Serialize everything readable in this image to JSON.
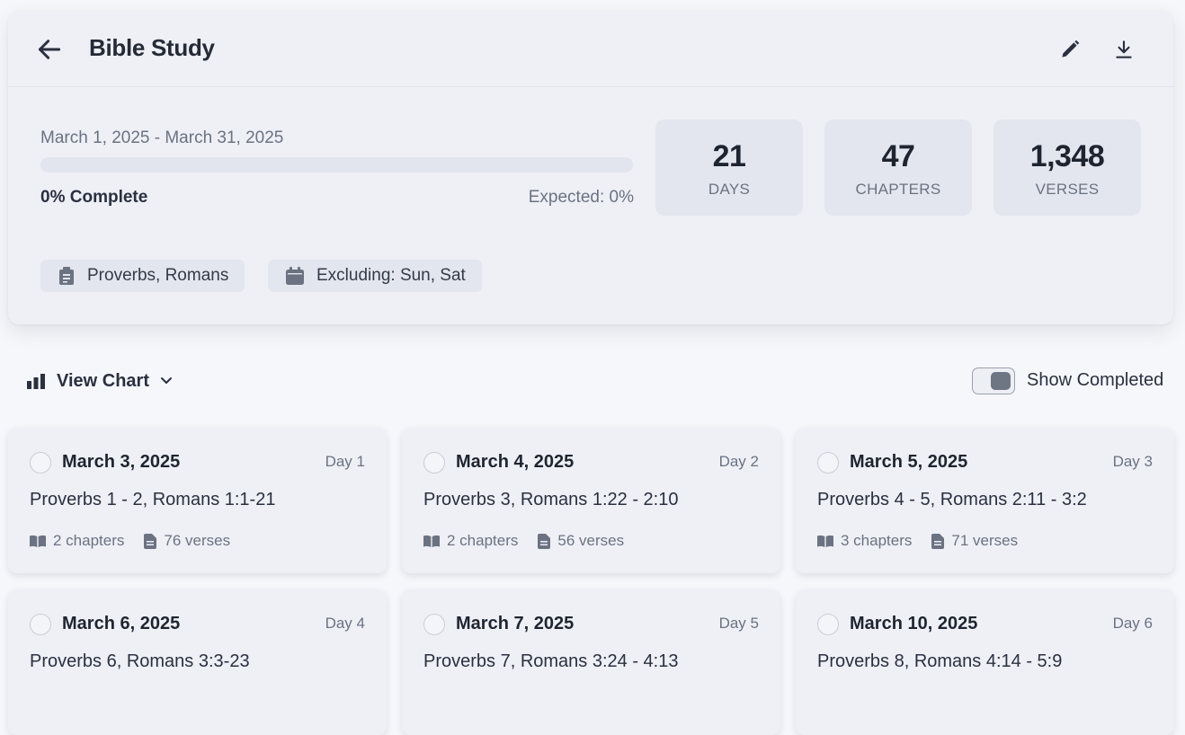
{
  "header": {
    "title": "Bible Study",
    "back_icon": "arrow-left-icon",
    "edit_icon": "pencil-icon",
    "download_icon": "download-icon"
  },
  "plan": {
    "date_range": "March 1, 2025 - March 31, 2025",
    "progress_fraction": 0,
    "complete_label": "0% Complete",
    "expected_label": "Expected: 0%"
  },
  "stats": [
    {
      "value": "21",
      "label": "DAYS"
    },
    {
      "value": "47",
      "label": "CHAPTERS"
    },
    {
      "value": "1,348",
      "label": "VERSES"
    }
  ],
  "chips": {
    "books": "Proverbs, Romans",
    "excluding": "Excluding: Sun, Sat"
  },
  "controls": {
    "view_chart_label": "View Chart",
    "show_completed_label": "Show Completed",
    "show_completed_on": false
  },
  "days": [
    {
      "date": "March 3, 2025",
      "day": "Day 1",
      "reading": "Proverbs 1 - 2, Romans 1:1-21",
      "chapters": "2 chapters",
      "verses": "76 verses"
    },
    {
      "date": "March 4, 2025",
      "day": "Day 2",
      "reading": "Proverbs 3, Romans 1:22 - 2:10",
      "chapters": "2 chapters",
      "verses": "56 verses"
    },
    {
      "date": "March 5, 2025",
      "day": "Day 3",
      "reading": "Proverbs 4 - 5, Romans 2:11 - 3:2",
      "chapters": "3 chapters",
      "verses": "71 verses"
    },
    {
      "date": "March 6, 2025",
      "day": "Day 4",
      "reading": "Proverbs 6, Romans 3:3-23",
      "chapters": "",
      "verses": ""
    },
    {
      "date": "March 7, 2025",
      "day": "Day 5",
      "reading": "Proverbs 7, Romans 3:24 - 4:13",
      "chapters": "",
      "verses": ""
    },
    {
      "date": "March 10, 2025",
      "day": "Day 6",
      "reading": "Proverbs 8, Romans 4:14 - 5:9",
      "chapters": "",
      "verses": ""
    }
  ],
  "colors": {
    "card_bg": "#eef0f6",
    "page_bg": "#f6f7fa",
    "stat_bg": "#e3e6ee",
    "text_primary": "#1f2530",
    "text_muted": "#6b7281"
  }
}
